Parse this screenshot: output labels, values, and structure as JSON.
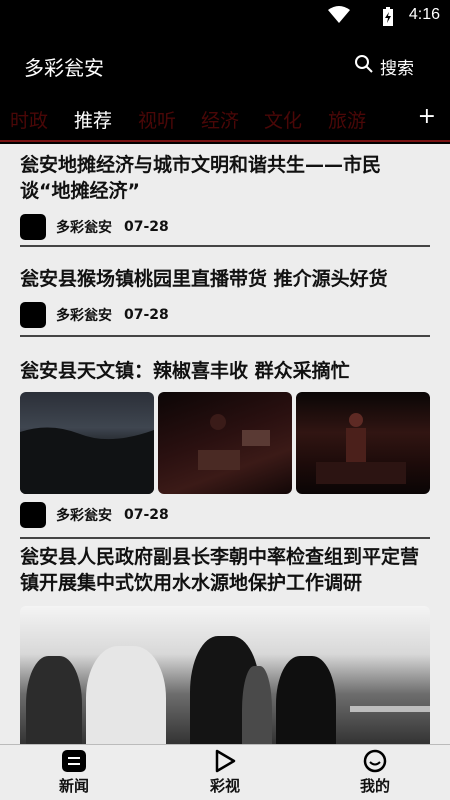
{
  "status_bar": {
    "time": "4:16",
    "icons": [
      "wifi-icon",
      "battery-charging-icon"
    ]
  },
  "header": {
    "app_title": "多彩瓮安",
    "search_label": "搜索",
    "search_icon": "search-icon"
  },
  "tabs": [
    {
      "label": "时政",
      "active": false
    },
    {
      "label": "推荐",
      "active": true
    },
    {
      "label": "视听",
      "active": false
    },
    {
      "label": "经济",
      "active": false
    },
    {
      "label": "文化",
      "active": false
    },
    {
      "label": "旅游",
      "active": false
    }
  ],
  "tabs_more": "+",
  "articles": [
    {
      "headline": "瓮安地摊经济与城市文明和谐共生——市民谈“地摊经济”",
      "source": "多彩瓮安",
      "date": "07-28"
    },
    {
      "headline": "瓮安县猴场镇桃园里直播带货 推介源头好货",
      "source": "多彩瓮安",
      "date": "07-28"
    },
    {
      "headline": "瓮安县天文镇：辣椒喜丰收 群众采摘忙",
      "source": "多彩瓮安",
      "date": "07-28"
    },
    {
      "headline": "瓮安县人民政府副县长李朝中率检查组到平定营镇开展集中式饮用水水源地保护工作调研"
    }
  ],
  "bottom_nav": [
    {
      "label": "新闻",
      "icon": "news-icon"
    },
    {
      "label": "彩视",
      "icon": "play-icon"
    },
    {
      "label": "我的",
      "icon": "profile-icon"
    }
  ]
}
